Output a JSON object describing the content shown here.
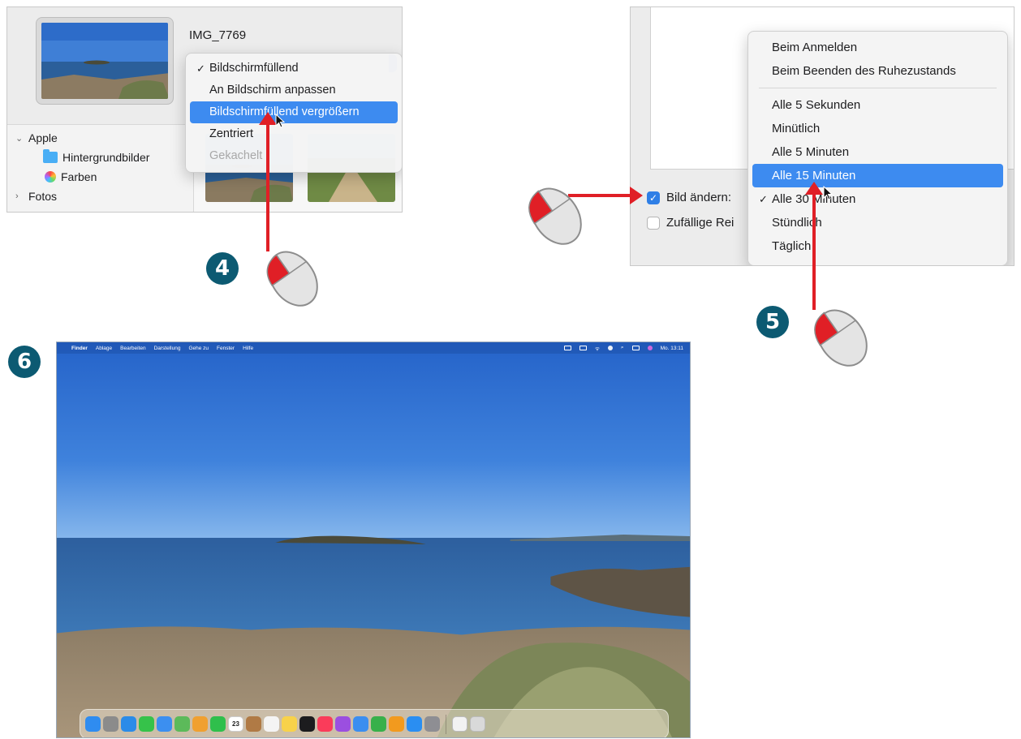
{
  "panel4": {
    "badge": "4",
    "filename": "IMG_7769",
    "menu": [
      {
        "label": "Bildschirmfüllend",
        "checked": true,
        "state": "normal"
      },
      {
        "label": "An Bildschirm anpassen",
        "checked": false,
        "state": "normal"
      },
      {
        "label": "Bildschirmfüllend vergrößern",
        "checked": false,
        "state": "selected"
      },
      {
        "label": "Zentriert",
        "checked": false,
        "state": "normal"
      },
      {
        "label": "Gekachelt",
        "checked": false,
        "state": "disabled"
      }
    ],
    "sidebar": {
      "group_label": "Apple",
      "items": [
        {
          "label": "Hintergrundbilder",
          "icon": "folder-icon"
        },
        {
          "label": "Farben",
          "icon": "color-wheel-icon"
        }
      ],
      "collapsed_label": "Fotos"
    }
  },
  "panel5": {
    "badge": "5",
    "change_checkbox": {
      "label": "Bild ändern:",
      "checked": true
    },
    "random_checkbox": {
      "label": "Zufällige Rei",
      "checked": false
    },
    "menu_top": [
      {
        "label": "Beim Anmelden",
        "checked": false,
        "state": "normal"
      },
      {
        "label": "Beim Beenden des Ruhezustands",
        "checked": false,
        "state": "normal"
      }
    ],
    "menu_bottom": [
      {
        "label": "Alle 5 Sekunden",
        "checked": false,
        "state": "normal"
      },
      {
        "label": "Minütlich",
        "checked": false,
        "state": "normal"
      },
      {
        "label": "Alle 5 Minuten",
        "checked": false,
        "state": "normal"
      },
      {
        "label": "Alle 15 Minuten",
        "checked": false,
        "state": "selected"
      },
      {
        "label": "Alle 30 Minuten",
        "checked": true,
        "state": "normal"
      },
      {
        "label": "Stündlich",
        "checked": false,
        "state": "normal"
      },
      {
        "label": "Täglich",
        "checked": false,
        "state": "normal"
      }
    ]
  },
  "desktop": {
    "badge": "6",
    "menubar": {
      "app": "Finder",
      "items": [
        "Ablage",
        "Bearbeiten",
        "Darstellung",
        "Gehe zu",
        "Fenster",
        "Hilfe"
      ],
      "clock": "Mo. 13:11"
    },
    "calendar_day": "23",
    "dock_icons": [
      {
        "name": "finder-icon",
        "color": "#2f8cf0"
      },
      {
        "name": "launchpad-icon",
        "color": "#8b8b8b"
      },
      {
        "name": "safari-icon",
        "color": "#2b8be8"
      },
      {
        "name": "messages-icon",
        "color": "#36c24a"
      },
      {
        "name": "mail-icon",
        "color": "#3c8ff0"
      },
      {
        "name": "maps-icon",
        "color": "#5cba5a"
      },
      {
        "name": "photos-icon",
        "color": "#f0a030"
      },
      {
        "name": "facetime-icon",
        "color": "#2fbf4c"
      },
      {
        "name": "calendar-icon",
        "color": "#ffffff"
      },
      {
        "name": "contacts-icon",
        "color": "#b07a45"
      },
      {
        "name": "reminders-icon",
        "color": "#f4f4f4"
      },
      {
        "name": "notes-icon",
        "color": "#f8d24a"
      },
      {
        "name": "apple-tv-icon",
        "color": "#1c1c1e"
      },
      {
        "name": "music-icon",
        "color": "#fa3c5a"
      },
      {
        "name": "podcasts-icon",
        "color": "#9b4fe0"
      },
      {
        "name": "keynote-icon",
        "color": "#3b8ef0"
      },
      {
        "name": "numbers-icon",
        "color": "#38b04a"
      },
      {
        "name": "pages-icon",
        "color": "#f29a1e"
      },
      {
        "name": "app-store-icon",
        "color": "#2a8ef2"
      },
      {
        "name": "system-preferences-icon",
        "color": "#8e8e93"
      }
    ],
    "dock_right_icons": [
      {
        "name": "document-icon",
        "color": "#f2f2f2"
      },
      {
        "name": "trash-icon",
        "color": "#d9d9d9"
      }
    ]
  },
  "colors": {
    "badge": "#0c5a72",
    "arrow": "#e01f26",
    "menu_selected": "#3d8bf0",
    "checkbox_on": "#2f7fe6"
  }
}
